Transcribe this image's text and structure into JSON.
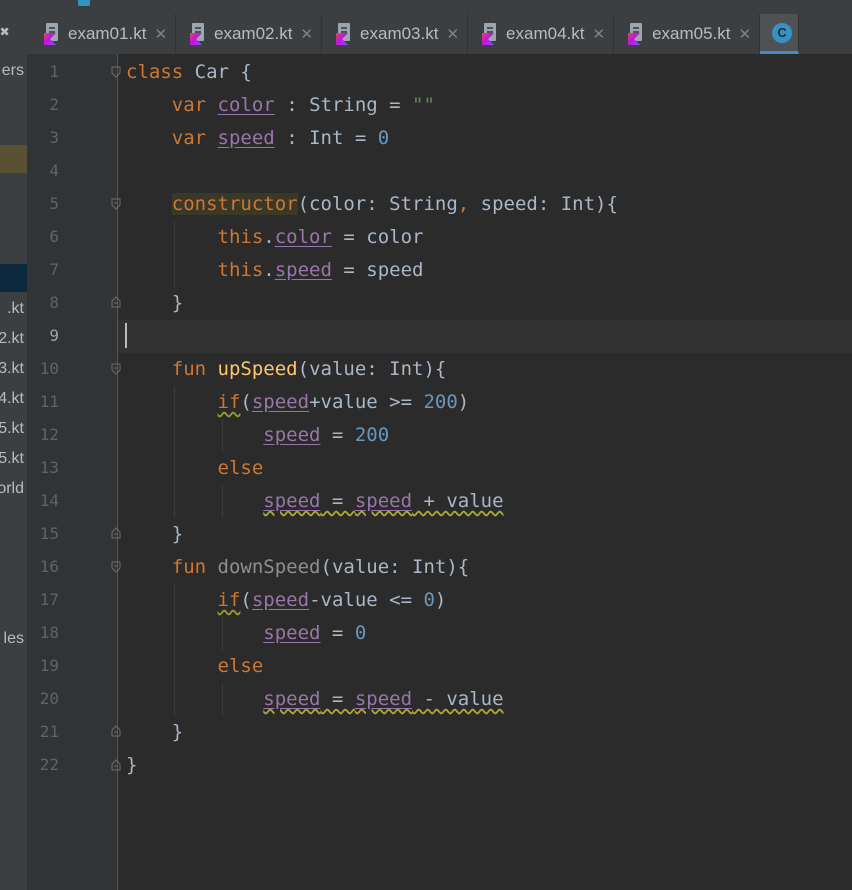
{
  "tabs": [
    {
      "label": "exam01.kt",
      "type": "kotlin"
    },
    {
      "label": "exam02.kt",
      "type": "kotlin"
    },
    {
      "label": "exam03.kt",
      "type": "kotlin"
    },
    {
      "label": "exam04.kt",
      "type": "kotlin"
    },
    {
      "label": "exam05.kt",
      "type": "kotlin"
    },
    {
      "label": "C",
      "type": "class-active"
    }
  ],
  "tab_close_glyph": "✕",
  "project_panel": {
    "top_glyph": "✖",
    "items": [
      "ers",
      ".kt",
      "2.kt",
      "3.kt",
      "4.kt",
      "5.kt",
      "5.kt",
      "orld",
      "les"
    ]
  },
  "line_numbers": [
    "1",
    "2",
    "3",
    "4",
    "5",
    "6",
    "7",
    "8",
    "9",
    "10",
    "11",
    "12",
    "13",
    "14",
    "15",
    "16",
    "17",
    "18",
    "19",
    "20",
    "21",
    "22"
  ],
  "current_line": "9",
  "code": {
    "l1": {
      "kw": "class",
      "name": " Car {"
    },
    "l2": {
      "kw": "var",
      "prop": "color",
      "rest": " : String = ",
      "str": "\"\""
    },
    "l3": {
      "kw": "var",
      "prop": "speed",
      "rest": " : Int = ",
      "num": "0"
    },
    "l5": {
      "kw": "constructor",
      "rest1": "(color: String",
      "comma": ",",
      "rest2": " speed: Int){"
    },
    "l6": {
      "kw": "this",
      "dot": ".",
      "prop": "color",
      "rest": " = color"
    },
    "l7": {
      "kw": "this",
      "dot": ".",
      "prop": "speed",
      "rest": " = speed"
    },
    "l8": {
      "text": "}"
    },
    "l10": {
      "kw": "fun",
      "fn": "upSpeed",
      "rest": "(value: Int){"
    },
    "l11": {
      "kw": "if",
      "p1": "(",
      "prop": "speed",
      "rest": "+value >= ",
      "num": "200",
      "p2": ")"
    },
    "l12": {
      "prop": "speed",
      "rest": " = ",
      "num": "200"
    },
    "l13": {
      "kw": "else"
    },
    "l14": {
      "prop1": "speed",
      "mid": " = ",
      "prop2": "speed",
      "rest": " + value"
    },
    "l15": {
      "text": "}"
    },
    "l16": {
      "kw": "fun",
      "fn": "downSpeed",
      "rest": "(value: Int){"
    },
    "l17": {
      "kw": "if",
      "p1": "(",
      "prop": "speed",
      "rest": "-value <= ",
      "num": "0",
      "p2": ")"
    },
    "l18": {
      "prop": "speed",
      "rest": " = ",
      "num": "0"
    },
    "l19": {
      "kw": "else"
    },
    "l20": {
      "prop1": "speed",
      "mid": " = ",
      "prop2": "speed",
      "rest": " - value"
    },
    "l21": {
      "text": "}"
    },
    "l22": {
      "text": "}"
    }
  },
  "colors": {
    "editor_bg": "#2b2b2b",
    "keyword": "#cc7832",
    "property": "#9876aa",
    "number": "#6897bb",
    "string": "#6a8759",
    "function": "#ffc66d",
    "text": "#a9b7c6"
  }
}
